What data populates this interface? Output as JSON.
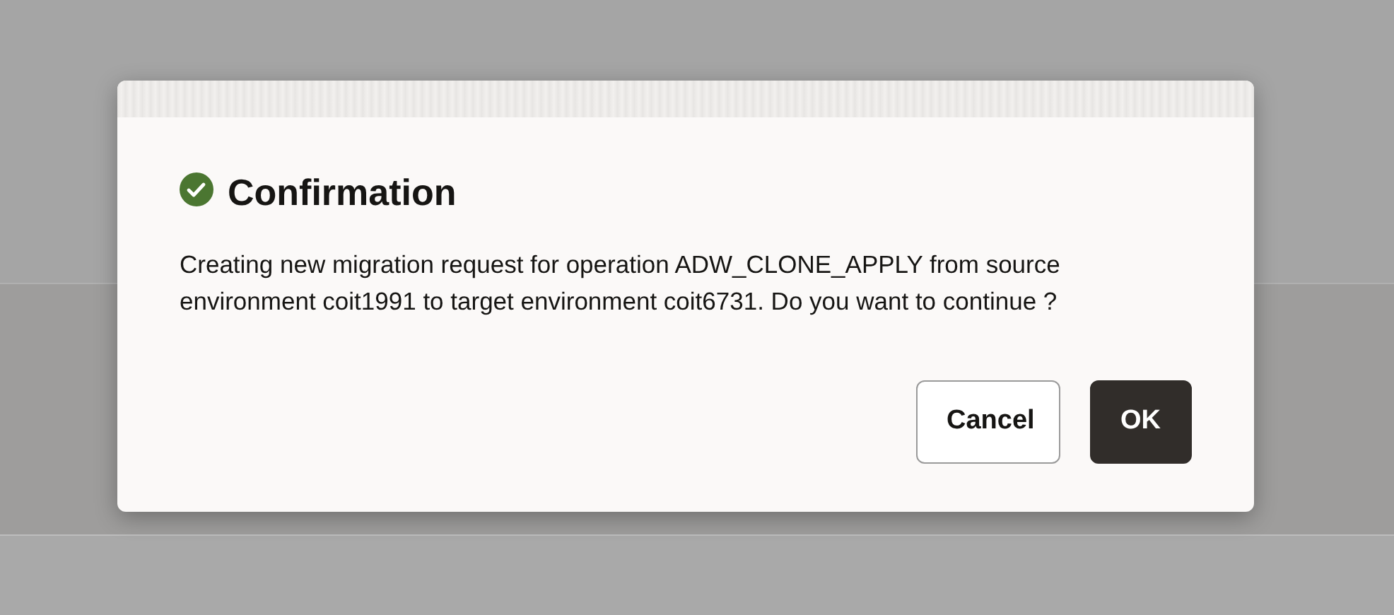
{
  "dialog": {
    "kind": "success",
    "title": "Confirmation",
    "message": "Creating new migration request for operation ADW_CLONE_APPLY from source environment coit1991 to target environment coit6731. Do you want to continue ?",
    "buttons": [
      {
        "label": "Cancel",
        "kind": "secondary"
      },
      {
        "label": "OK",
        "kind": "primary"
      }
    ]
  }
}
